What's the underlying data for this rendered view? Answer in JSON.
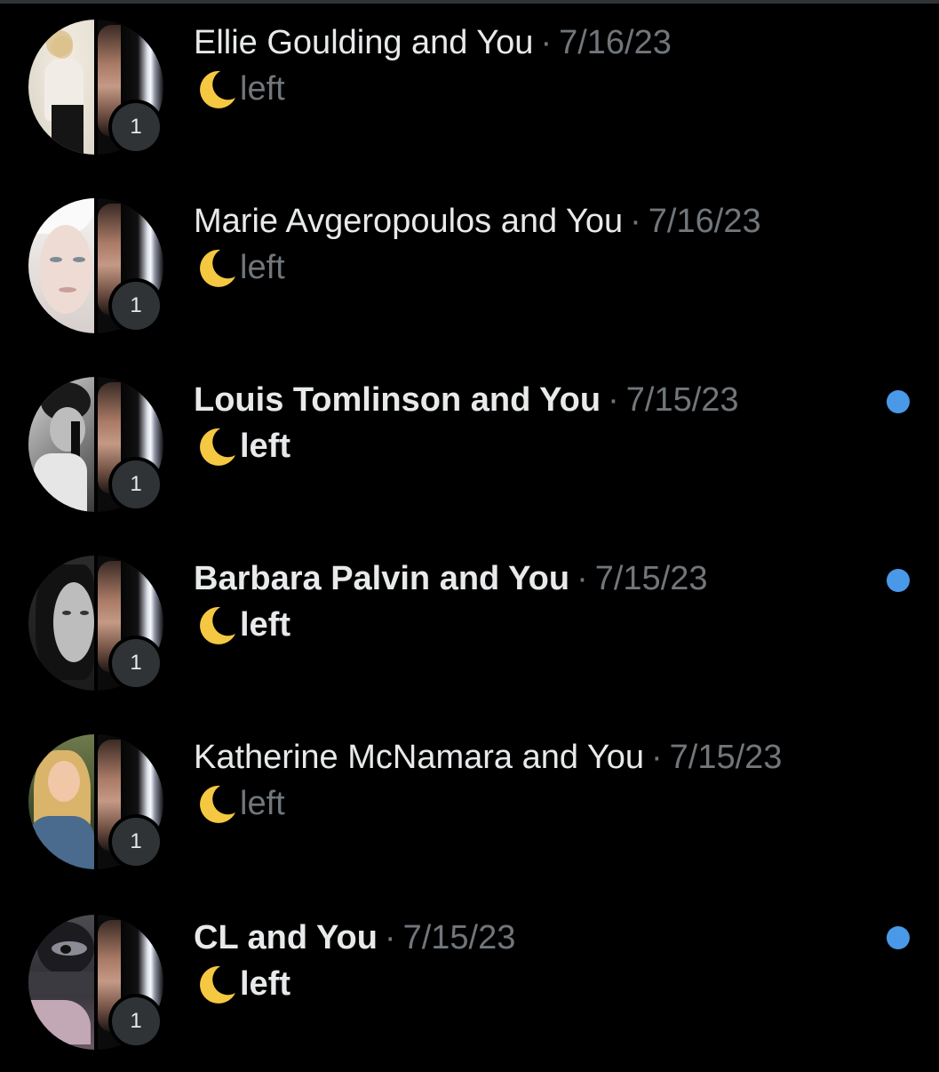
{
  "conversations": [
    {
      "name": "Ellie Goulding and You",
      "sep": "·",
      "date": "7/16/23",
      "message": "left",
      "badge": "1",
      "unread": false,
      "avatar_icon": "group-avatar-icon"
    },
    {
      "name": "Marie Avgeropoulos and You",
      "sep": "·",
      "date": "7/16/23",
      "message": "left",
      "badge": "1",
      "unread": false,
      "avatar_icon": "group-avatar-icon"
    },
    {
      "name": "Louis Tomlinson and You",
      "sep": "·",
      "date": "7/15/23",
      "message": "left",
      "badge": "1",
      "unread": true,
      "avatar_icon": "group-avatar-icon"
    },
    {
      "name": "Barbara Palvin and You",
      "sep": "·",
      "date": "7/15/23",
      "message": "left",
      "badge": "1",
      "unread": true,
      "avatar_icon": "group-avatar-icon"
    },
    {
      "name": "Katherine McNamara and You",
      "sep": "·",
      "date": "7/15/23",
      "message": "left",
      "badge": "1",
      "unread": false,
      "avatar_icon": "group-avatar-icon"
    },
    {
      "name": "CL and You",
      "sep": "·",
      "date": "7/15/23",
      "message": "left",
      "badge": "1",
      "unread": true,
      "avatar_icon": "group-avatar-icon"
    }
  ],
  "colors": {
    "background": "#000000",
    "text_primary": "#e7e9ea",
    "text_secondary": "#71767b",
    "unread_dot": "#4a99e9",
    "badge_bg": "#2f3336",
    "moon": "#f5c842"
  },
  "icons": {
    "message_prefix": "crescent-moon-icon",
    "unread_indicator": "unread-dot-icon"
  }
}
